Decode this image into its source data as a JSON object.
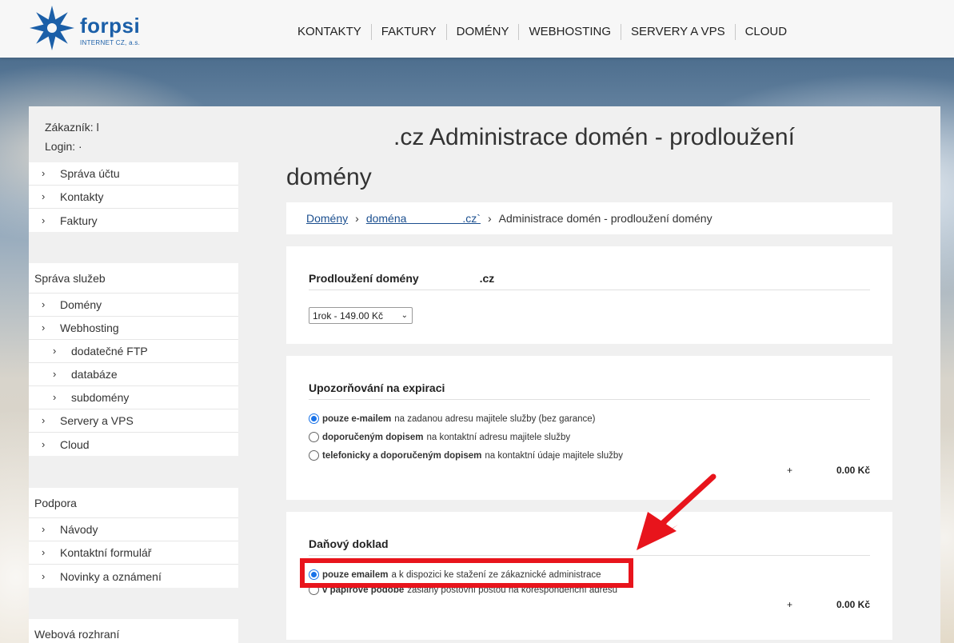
{
  "header": {
    "brand": "forpsi",
    "brand_sub": "INTERNET CZ, a.s.",
    "nav": [
      "KONTAKTY",
      "FAKTURY",
      "DOMÉNY",
      "WEBHOSTING",
      "SERVERY A VPS",
      "CLOUD"
    ]
  },
  "user": {
    "customer_label": "Zákazník: l",
    "login_label": "Login: ·"
  },
  "sidebar": {
    "account": [
      "Správa účtu",
      "Kontakty",
      "Faktury"
    ],
    "services_title": "Správa služeb",
    "services": [
      {
        "label": "Domény",
        "sub": false
      },
      {
        "label": "Webhosting",
        "sub": false
      },
      {
        "label": "dodatečné FTP",
        "sub": true
      },
      {
        "label": "databáze",
        "sub": true
      },
      {
        "label": "subdomény",
        "sub": true
      },
      {
        "label": "Servery a VPS",
        "sub": false
      },
      {
        "label": "Cloud",
        "sub": false
      }
    ],
    "support_title": "Podpora",
    "support": [
      "Návody",
      "Kontaktní formulář",
      "Novinky a oznámení"
    ],
    "web_title": "Webová rozhraní"
  },
  "page": {
    "title_line1": ".cz Administrace domén - prodloužení",
    "title_line2": "domény"
  },
  "breadcrumb": {
    "link1": "Domény",
    "link2": "doména                  .cz`",
    "current": "Administrace domén - prodloužení domény"
  },
  "renewal": {
    "title": "Prodloužení domény",
    "title_suffix": ".cz",
    "select_value": "1rok - 149.00 Kč"
  },
  "expiry": {
    "title": "Upozorňování na expiraci",
    "options": [
      {
        "bold": "pouze e-mailem",
        "rest": "na zadanou adresu majitele služby (bez garance)",
        "checked": true
      },
      {
        "bold": "doporučeným dopisem",
        "rest": "na kontaktní adresu majitele služby",
        "checked": false
      },
      {
        "bold": "telefonicky a doporučeným dopisem",
        "rest": "na kontaktní údaje majitele služby",
        "checked": false
      }
    ],
    "plus": "+",
    "amount": "0.00 Kč"
  },
  "tax": {
    "title": "Daňový doklad",
    "options": [
      {
        "bold": "pouze emailem",
        "rest": "a k dispozici ke stažení ze zákaznické administrace",
        "checked": true
      },
      {
        "bold": "v papírové podobě",
        "rest": "zaslaný poštovní poštou na korespondenční adresu",
        "checked": false
      }
    ],
    "plus": "+",
    "amount": "0.00 Kč"
  },
  "colors": {
    "brand": "#1b5fa8",
    "highlight": "#e8141c",
    "radio_checked": "#1a73e8"
  }
}
